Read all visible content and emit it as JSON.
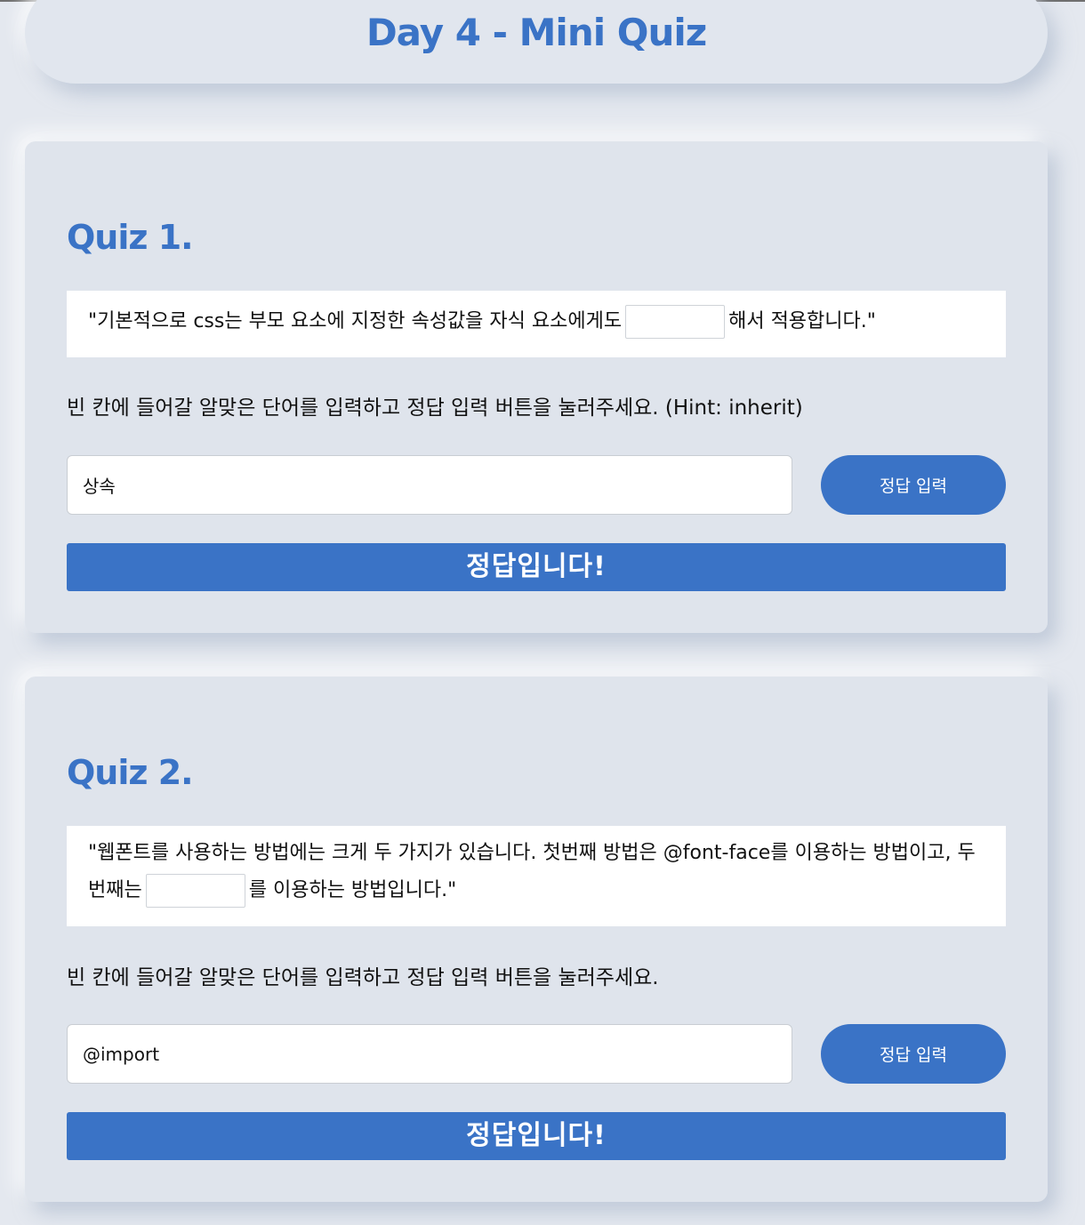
{
  "header": {
    "title": "Day 4 - Mini Quiz"
  },
  "quizzes": [
    {
      "title": "Quiz 1.",
      "question_before": "\"기본적으로 css는 부모 요소에 지정한 속성값을 자식 요소에게도",
      "question_after": "해서 적용합니다.\"",
      "instruction": "빈 칸에 들어갈 알맞은 단어를 입력하고 정답 입력 버튼을 눌러주세요. (Hint: inherit)",
      "answer_value": "상속",
      "submit_label": "정답 입력",
      "result": "정답입니다!"
    },
    {
      "title": "Quiz 2.",
      "question_before": "\"웹폰트를 사용하는 방법에는 크게 두 가지가 있습니다. 첫번째 방법은 @font-face를 이용하는 방법이고, 두 번째는",
      "question_after": "를 이용하는 방법입니다.\"",
      "instruction": "빈 칸에 들어갈 알맞은 단어를 입력하고 정답 입력 버튼을 눌러주세요.",
      "answer_value": "@import",
      "submit_label": "정답 입력",
      "result": "정답입니다!"
    }
  ],
  "colors": {
    "accent": "#3a73c6",
    "background": "#e4e8ef",
    "card": "#dfe4ec"
  }
}
